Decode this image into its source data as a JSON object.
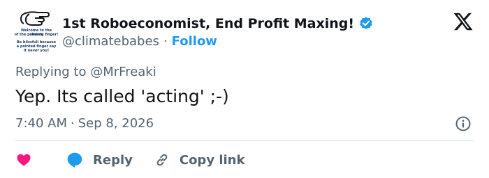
{
  "author": {
    "display_name": "1st Roboeconomist, End Profit Maxing!",
    "handle": "@climatebabes",
    "separator": "·",
    "follow_label": "Follow",
    "verified": true,
    "verified_color": "#1d9bf0",
    "avatar": {
      "icon": "pointing-finger-icon",
      "line1": "Welcome to the church",
      "line2": "of the pointing finger!",
      "line3": "Be blissfull because",
      "line4": "a pointed finger say",
      "line5": "it never you!"
    }
  },
  "platform": {
    "logo_icon": "x-logo-icon"
  },
  "tweet": {
    "replying_prefix": "Replying to",
    "replying_to": "@MrFreaki",
    "text": "Yep. Its called 'acting' ;-)",
    "time": "7:40 AM",
    "date": "Sep 8, 2026",
    "separator": "·"
  },
  "actions": {
    "like_icon": "heart-icon",
    "like_color": "#f91880",
    "reply_icon": "chat-bubble-icon",
    "reply_color": "#1d9bf0",
    "reply_label": "Reply",
    "copy_icon": "link-icon",
    "copy_label": "Copy link",
    "info_icon": "info-icon"
  },
  "colors": {
    "text_primary": "#0f1419",
    "text_secondary": "#536471",
    "accent": "#1d9bf0",
    "divider": "#cfd9de"
  }
}
